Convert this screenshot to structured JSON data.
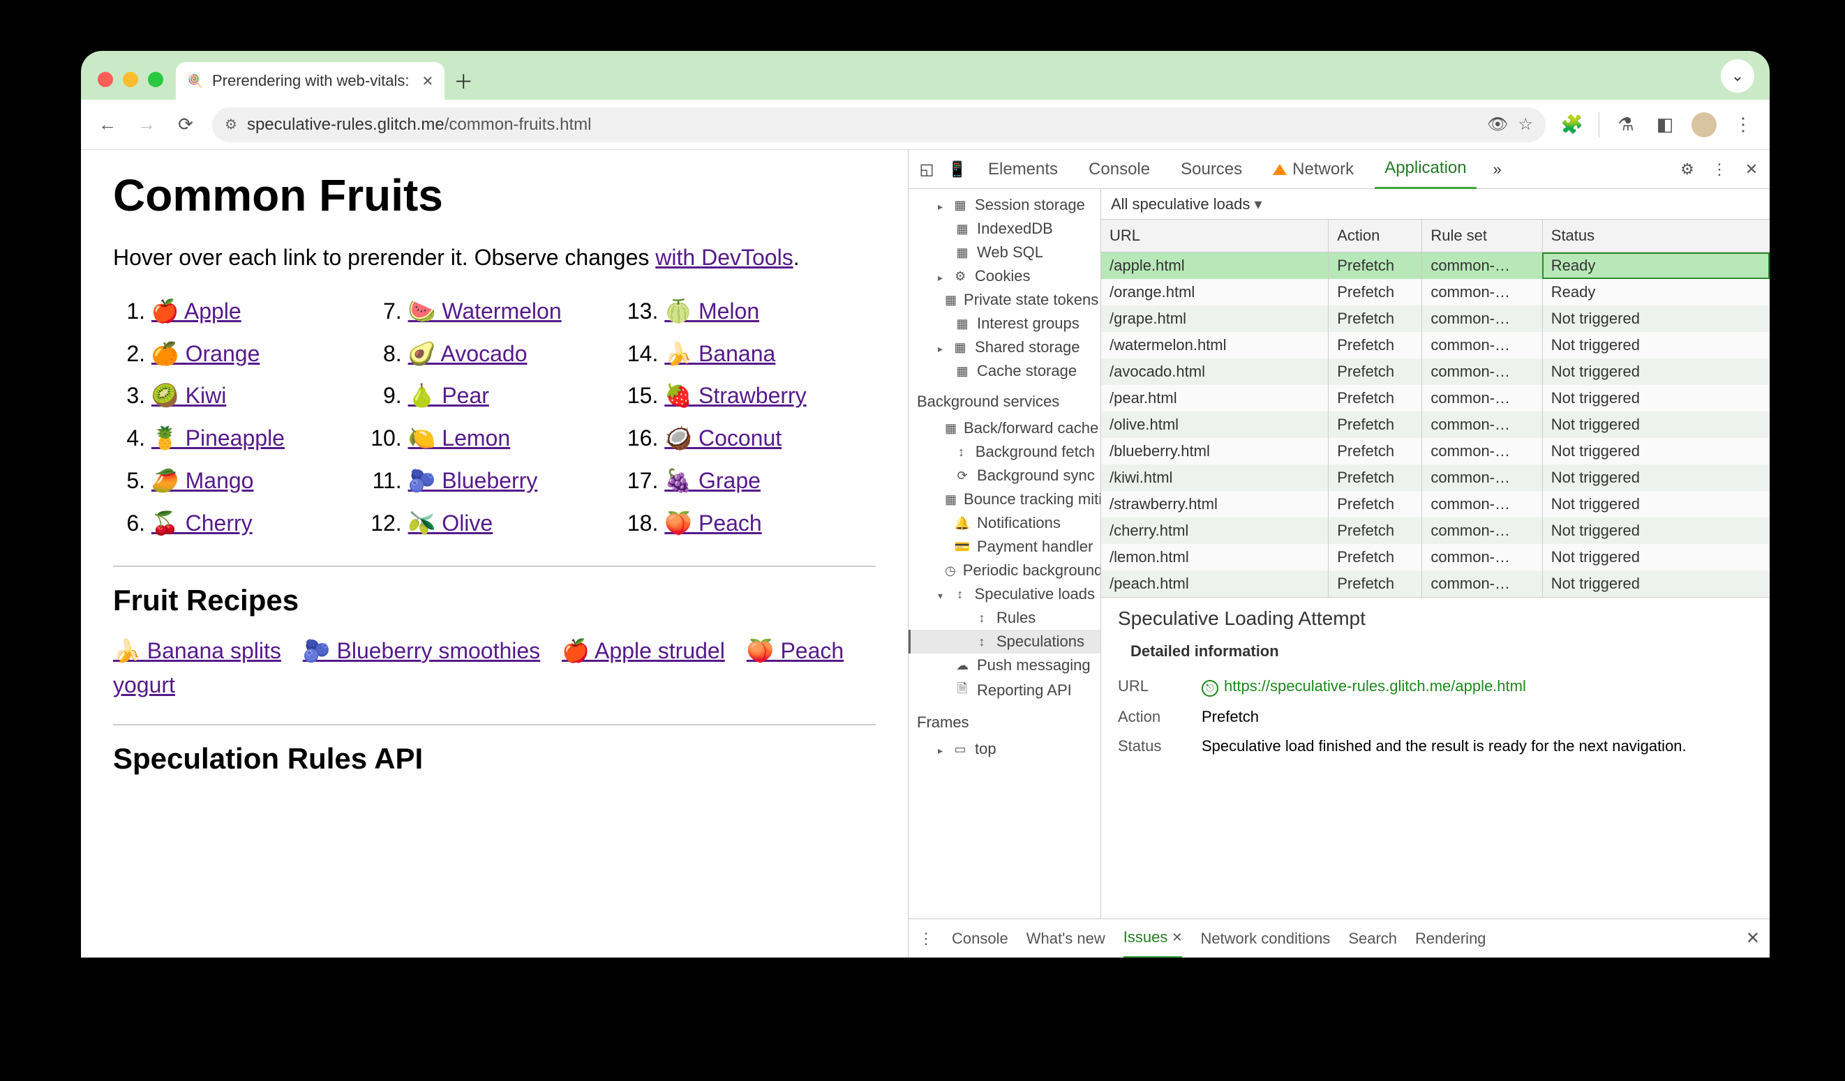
{
  "browser": {
    "tab_title": "Prerendering with web-vitals:",
    "url_host": "speculative-rules.glitch.me",
    "url_path": "/common-fruits.html"
  },
  "page": {
    "h1": "Common Fruits",
    "intro_pre": "Hover over each link to prerender it. Observe changes ",
    "intro_link": "with DevTools",
    "intro_post": ".",
    "fruits": [
      {
        "n": "1.",
        "e": "🍎",
        "t": "Apple"
      },
      {
        "n": "2.",
        "e": "🍊",
        "t": "Orange"
      },
      {
        "n": "3.",
        "e": "🥝",
        "t": "Kiwi"
      },
      {
        "n": "4.",
        "e": "🍍",
        "t": "Pineapple"
      },
      {
        "n": "5.",
        "e": "🥭",
        "t": "Mango"
      },
      {
        "n": "6.",
        "e": "🍒",
        "t": "Cherry"
      },
      {
        "n": "7.",
        "e": "🍉",
        "t": "Watermelon"
      },
      {
        "n": "8.",
        "e": "🥑",
        "t": "Avocado"
      },
      {
        "n": "9.",
        "e": "🍐",
        "t": "Pear"
      },
      {
        "n": "10.",
        "e": "🍋",
        "t": "Lemon"
      },
      {
        "n": "11.",
        "e": "🫐",
        "t": "Blueberry"
      },
      {
        "n": "12.",
        "e": "🫒",
        "t": "Olive"
      },
      {
        "n": "13.",
        "e": "🍈",
        "t": "Melon"
      },
      {
        "n": "14.",
        "e": "🍌",
        "t": "Banana"
      },
      {
        "n": "15.",
        "e": "🍓",
        "t": "Strawberry"
      },
      {
        "n": "16.",
        "e": "🥥",
        "t": "Coconut"
      },
      {
        "n": "17.",
        "e": "🍇",
        "t": "Grape"
      },
      {
        "n": "18.",
        "e": "🍑",
        "t": "Peach"
      }
    ],
    "h2_recipes": "Fruit Recipes",
    "recipes": [
      {
        "e": "🍌",
        "t": "Banana splits"
      },
      {
        "e": "🫐",
        "t": "Blueberry smoothies"
      },
      {
        "e": "🍎",
        "t": "Apple strudel"
      },
      {
        "e": "🍑",
        "t": "Peach yogurt"
      }
    ],
    "h2_api": "Speculation Rules API"
  },
  "devtools": {
    "tabs": {
      "elements": "Elements",
      "console": "Console",
      "sources": "Sources",
      "network": "Network",
      "application": "Application"
    },
    "sidebar": {
      "items1": [
        {
          "icn": "▦",
          "t": "Session storage",
          "caret": true
        },
        {
          "icn": "▦",
          "t": "IndexedDB"
        },
        {
          "icn": "▦",
          "t": "Web SQL"
        },
        {
          "icn": "⚙",
          "t": "Cookies",
          "caret": true
        },
        {
          "icn": "▦",
          "t": "Private state tokens"
        },
        {
          "icn": "▦",
          "t": "Interest groups"
        },
        {
          "icn": "▦",
          "t": "Shared storage",
          "caret": true
        },
        {
          "icn": "▦",
          "t": "Cache storage"
        }
      ],
      "hdr_bg": "Background services",
      "items2": [
        {
          "icn": "▦",
          "t": "Back/forward cache"
        },
        {
          "icn": "↕",
          "t": "Background fetch"
        },
        {
          "icn": "⟳",
          "t": "Background sync"
        },
        {
          "icn": "▦",
          "t": "Bounce tracking mitigations"
        },
        {
          "icn": "🔔",
          "t": "Notifications"
        },
        {
          "icn": "💳",
          "t": "Payment handler"
        },
        {
          "icn": "◷",
          "t": "Periodic background"
        },
        {
          "icn": "↕",
          "t": "Speculative loads",
          "caret": true,
          "open": true
        },
        {
          "icn": "↕",
          "t": "Rules",
          "sub": true
        },
        {
          "icn": "↕",
          "t": "Speculations",
          "sub": true,
          "sel": true
        },
        {
          "icn": "☁",
          "t": "Push messaging"
        },
        {
          "icn": "🗎",
          "t": "Reporting API"
        }
      ],
      "hdr_frames": "Frames",
      "frames": [
        {
          "icn": "▭",
          "t": "top",
          "caret": true
        }
      ]
    },
    "filter": "All speculative loads",
    "table": {
      "cols": {
        "url": "URL",
        "action": "Action",
        "ruleset": "Rule set",
        "status": "Status"
      },
      "rows": [
        {
          "url": "/apple.html",
          "action": "Prefetch",
          "ruleset": "common-…",
          "status": "Ready",
          "sel": true
        },
        {
          "url": "/orange.html",
          "action": "Prefetch",
          "ruleset": "common-…",
          "status": "Ready"
        },
        {
          "url": "/grape.html",
          "action": "Prefetch",
          "ruleset": "common-…",
          "status": "Not triggered"
        },
        {
          "url": "/watermelon.html",
          "action": "Prefetch",
          "ruleset": "common-…",
          "status": "Not triggered"
        },
        {
          "url": "/avocado.html",
          "action": "Prefetch",
          "ruleset": "common-…",
          "status": "Not triggered"
        },
        {
          "url": "/pear.html",
          "action": "Prefetch",
          "ruleset": "common-…",
          "status": "Not triggered"
        },
        {
          "url": "/olive.html",
          "action": "Prefetch",
          "ruleset": "common-…",
          "status": "Not triggered"
        },
        {
          "url": "/blueberry.html",
          "action": "Prefetch",
          "ruleset": "common-…",
          "status": "Not triggered"
        },
        {
          "url": "/kiwi.html",
          "action": "Prefetch",
          "ruleset": "common-…",
          "status": "Not triggered"
        },
        {
          "url": "/strawberry.html",
          "action": "Prefetch",
          "ruleset": "common-…",
          "status": "Not triggered"
        },
        {
          "url": "/cherry.html",
          "action": "Prefetch",
          "ruleset": "common-…",
          "status": "Not triggered"
        },
        {
          "url": "/lemon.html",
          "action": "Prefetch",
          "ruleset": "common-…",
          "status": "Not triggered"
        },
        {
          "url": "/peach.html",
          "action": "Prefetch",
          "ruleset": "common-…",
          "status": "Not triggered"
        }
      ]
    },
    "detail": {
      "title": "Speculative Loading Attempt",
      "subtitle": "Detailed information",
      "url_label": "URL",
      "url_value": "https://speculative-rules.glitch.me/apple.html",
      "action_label": "Action",
      "action_value": "Prefetch",
      "status_label": "Status",
      "status_value": "Speculative load finished and the result is ready for the next navigation."
    },
    "drawer": {
      "console": "Console",
      "whatsnew": "What's new",
      "issues": "Issues",
      "netcond": "Network conditions",
      "search": "Search",
      "rendering": "Rendering"
    }
  }
}
